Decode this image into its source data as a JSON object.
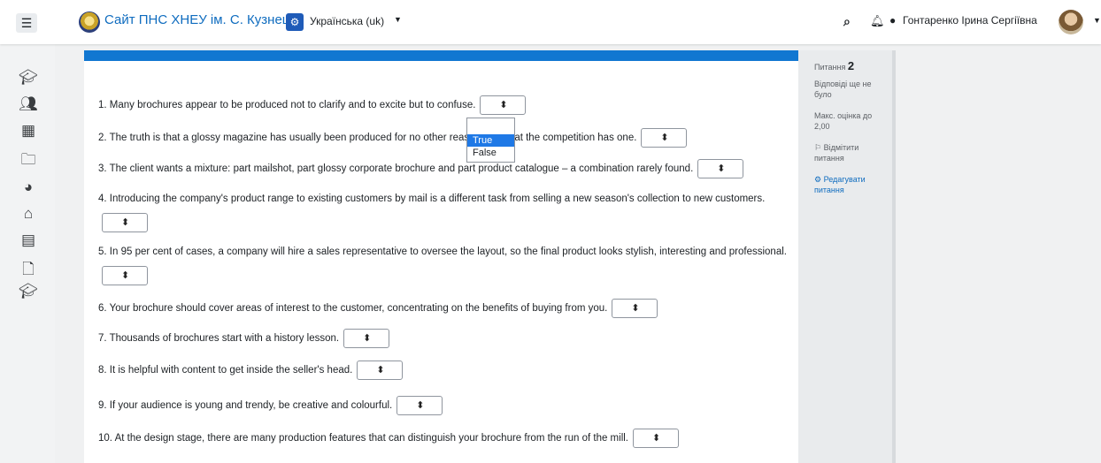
{
  "navbar": {
    "site_name": "Сайт ПНС ХНЕУ ім. С. Кузнеця",
    "language": "Українська (uk)",
    "user_name": "Гонтаренко Ірина Сергіївна"
  },
  "icons": {
    "menu": "hamburger-icon",
    "search": "search-icon",
    "bell": "bell-icon",
    "chat": "chat-icon"
  },
  "rail_icons": [
    "graduation-cap-icon",
    "users-icon",
    "table-icon",
    "folder-icon",
    "dashboard-icon",
    "home-icon",
    "calendar-icon",
    "file-icon",
    "graduation-cap-icon"
  ],
  "questions": [
    {
      "num": "1.",
      "text": "Many brochures appear to be produced not to clarify and to excite but to confuse."
    },
    {
      "num": "2.",
      "text": "The truth is that a glossy magazine has usually been produced for no other reason than that the competition has one."
    },
    {
      "num": "3.",
      "text": "The client wants a mixture: part mailshot, part glossy corporate brochure and part product catalogue – a combination rarely found."
    },
    {
      "num": "4.",
      "text": "Introducing the company's product range to existing customers by mail is a different task from selling a new season's collection to new customers."
    },
    {
      "num": "5.",
      "text": "In 95 per cent of cases, a company will hire a sales representative to oversee the layout, so the final product looks stylish, interesting and professional."
    },
    {
      "num": "6.",
      "text": "Your brochure should cover areas of interest to the customer, concentrating on the benefits of buying from you."
    },
    {
      "num": "7.",
      "text": "Thousands of brochures start with a history lesson."
    },
    {
      "num": "8.",
      "text": "It is helpful with content to get inside the seller's head."
    },
    {
      "num": "9.",
      "text": "If your audience is young and trendy, be creative and colourful."
    },
    {
      "num": "10.",
      "text": "At the design stage, there are many production features that can distinguish your brochure from the run of the mill."
    }
  ],
  "dropdown": {
    "options": [
      "True",
      "False"
    ],
    "highlighted": "True"
  },
  "sidebar_info": {
    "question_label": "Питання",
    "question_number": "2",
    "status": "Відповіді ще не було",
    "max_grade": "Макс. оцінка до 2,00",
    "flag_link": "Відмітити питання",
    "edit_link": "Редагувати питання"
  }
}
